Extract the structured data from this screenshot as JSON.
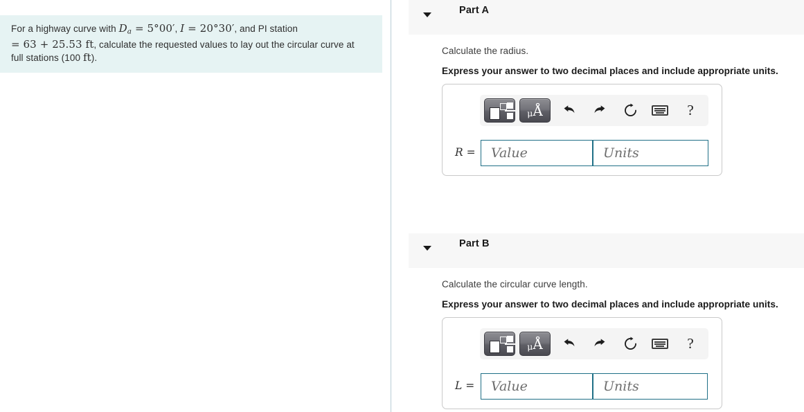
{
  "question": {
    "intro": "For a highway curve with ",
    "da_symbol": "D",
    "da_sub": "a",
    "eq1": " = 5°00′",
    "comma1": ", ",
    "i_symbol": "I",
    "eq2": " = 20°30′",
    "mid": ", and PI station",
    "line2_math": "= 63 + 25.53 ft",
    "line2_rest": ", calculate the requested values to lay out the circular curve at",
    "line3": "full stations (100 ",
    "line3_unit": "ft",
    "line3_end": ").",
    "background_color": "#e6f3f3"
  },
  "parts": [
    {
      "title": "Part A",
      "caret_icon": "chevron-down-icon",
      "prompt": "Calculate the radius.",
      "instruction": "Express your answer to two decimal places and include appropriate units.",
      "variable": "R",
      "equals": "=",
      "value_placeholder": "Value",
      "units_placeholder": "Units",
      "toolbar": {
        "template_button_label": "template-button",
        "unit_button_label": "μÅ",
        "unit_mu": "μ",
        "unit_angstrom": "Å",
        "undo_label": "undo-icon",
        "redo_label": "redo-icon",
        "reset_label": "reset-icon",
        "keyboard_label": "keyboard-icon",
        "help_label": "?"
      }
    },
    {
      "title": "Part B",
      "caret_icon": "chevron-down-icon",
      "prompt": "Calculate the circular curve length.",
      "instruction": "Express your answer to two decimal places and include appropriate units.",
      "variable": "L",
      "equals": "=",
      "value_placeholder": "Value",
      "units_placeholder": "Units",
      "toolbar": {
        "template_button_label": "template-button",
        "unit_button_label": "μÅ",
        "unit_mu": "μ",
        "unit_angstrom": "Å",
        "undo_label": "undo-icon",
        "redo_label": "redo-icon",
        "reset_label": "reset-icon",
        "keyboard_label": "keyboard-icon",
        "help_label": "?"
      }
    }
  ],
  "colors": {
    "question_bg": "#e6f3f3",
    "part_header_bg": "#f7f7f7",
    "input_border": "#1f6f86",
    "divider": "#b9cdd6"
  }
}
